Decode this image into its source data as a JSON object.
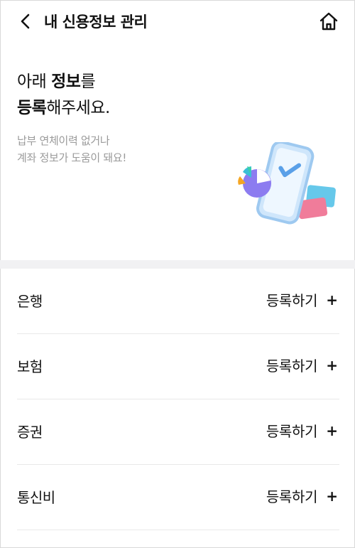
{
  "header": {
    "title": "내 신용정보 관리",
    "back_icon": "chevron-left-icon",
    "home_icon": "home-icon"
  },
  "hero": {
    "headline_line1_pre": "아래 ",
    "headline_line1_bold": "정보",
    "headline_line1_post": "를",
    "headline_line2_bold": "등록",
    "headline_line2_post": "해주세요.",
    "sub_line1": "납부 연체이력 없거나",
    "sub_line2": "계좌 정보가 도움이 돼요!",
    "illustration": "phone-checkmark-illustration"
  },
  "list": {
    "items": [
      {
        "label": "은행",
        "action": "등록하기",
        "icon": "+"
      },
      {
        "label": "보험",
        "action": "등록하기",
        "icon": "+"
      },
      {
        "label": "증권",
        "action": "등록하기",
        "icon": "+"
      },
      {
        "label": "통신비",
        "action": "등록하기",
        "icon": "+"
      }
    ]
  },
  "colors": {
    "text": "#111111",
    "subtext": "#9a9a9a",
    "band": "#f1f1f3",
    "divider": "#e9e9e9",
    "phone": "#9ec9f0",
    "check": "#5aa0e8",
    "card_pink": "#f07c9a",
    "card_blue": "#66c8ea"
  }
}
